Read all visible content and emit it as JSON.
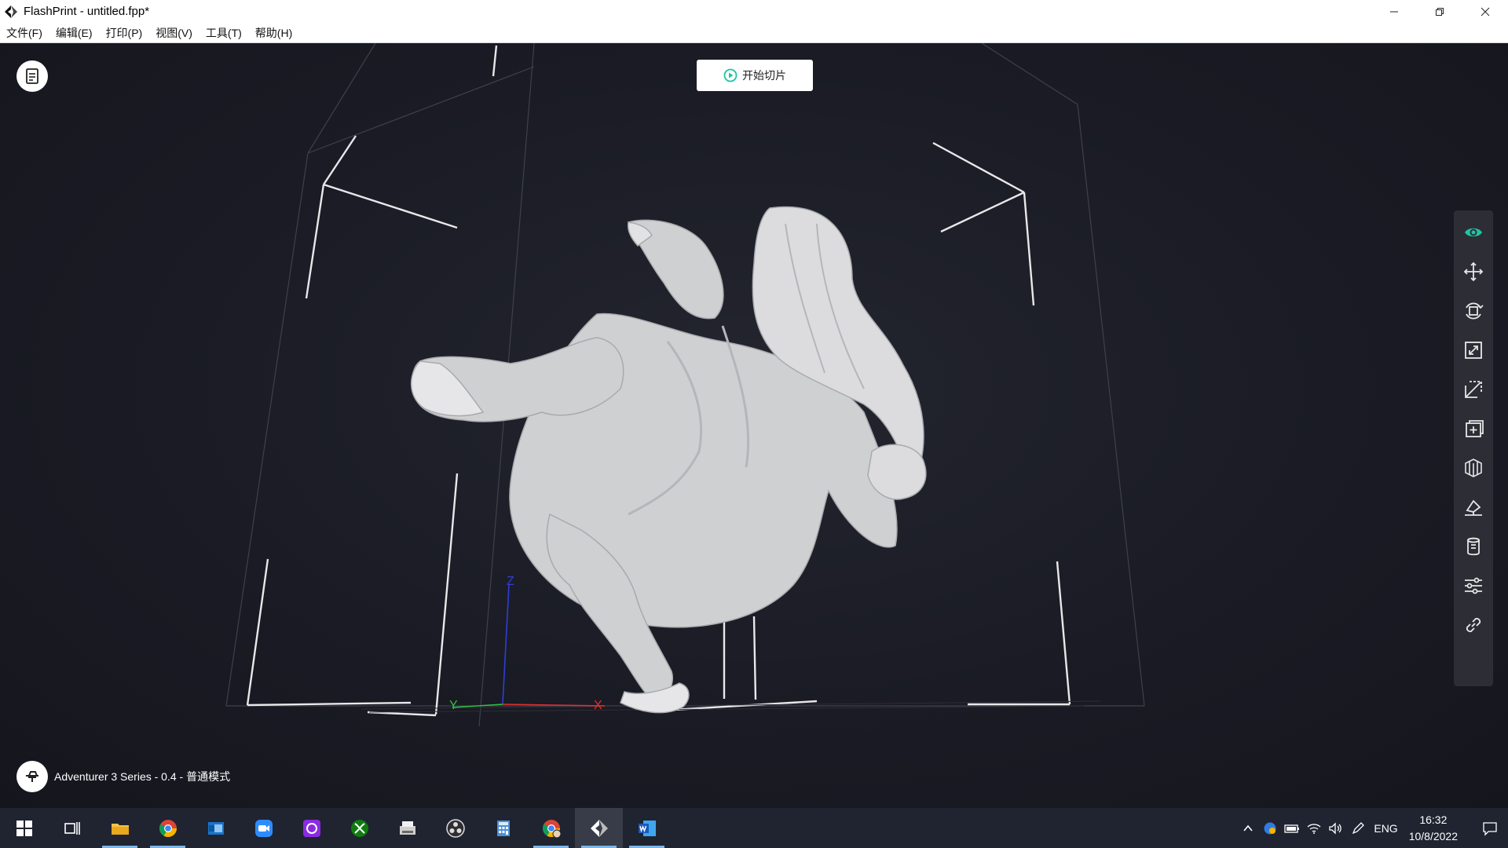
{
  "window": {
    "title": "FlashPrint - untitled.fpp*",
    "controls": [
      "minimize-icon",
      "restore-icon",
      "close-icon"
    ]
  },
  "menu": {
    "items": [
      "文件(F)",
      "编辑(E)",
      "打印(P)",
      "视图(V)",
      "工具(T)",
      "帮助(H)"
    ]
  },
  "viewport": {
    "slice_button_label": "开始切片",
    "printer_label": "Adventurer 3 Series - 0.4 - 普通模式",
    "axes": {
      "x": "X",
      "y": "Y",
      "z": "Z"
    },
    "accent_color": "#1fc4a3",
    "active_tool": "view"
  },
  "toolbar": {
    "tools": [
      "view",
      "move",
      "rotate",
      "scale",
      "cut",
      "add-model",
      "supports",
      "lay-flat",
      "extruder",
      "settings",
      "connect"
    ]
  },
  "taskbar": {
    "apps": [
      "start",
      "task-view",
      "file-explorer",
      "chrome",
      "outlook",
      "zoom",
      "rewind",
      "xbox",
      "scanner",
      "obs",
      "calculator",
      "chrome-profile",
      "flashprint",
      "word"
    ],
    "active_app": "flashprint",
    "language": "ENG",
    "time": "16:32",
    "date": "10/8/2022"
  }
}
